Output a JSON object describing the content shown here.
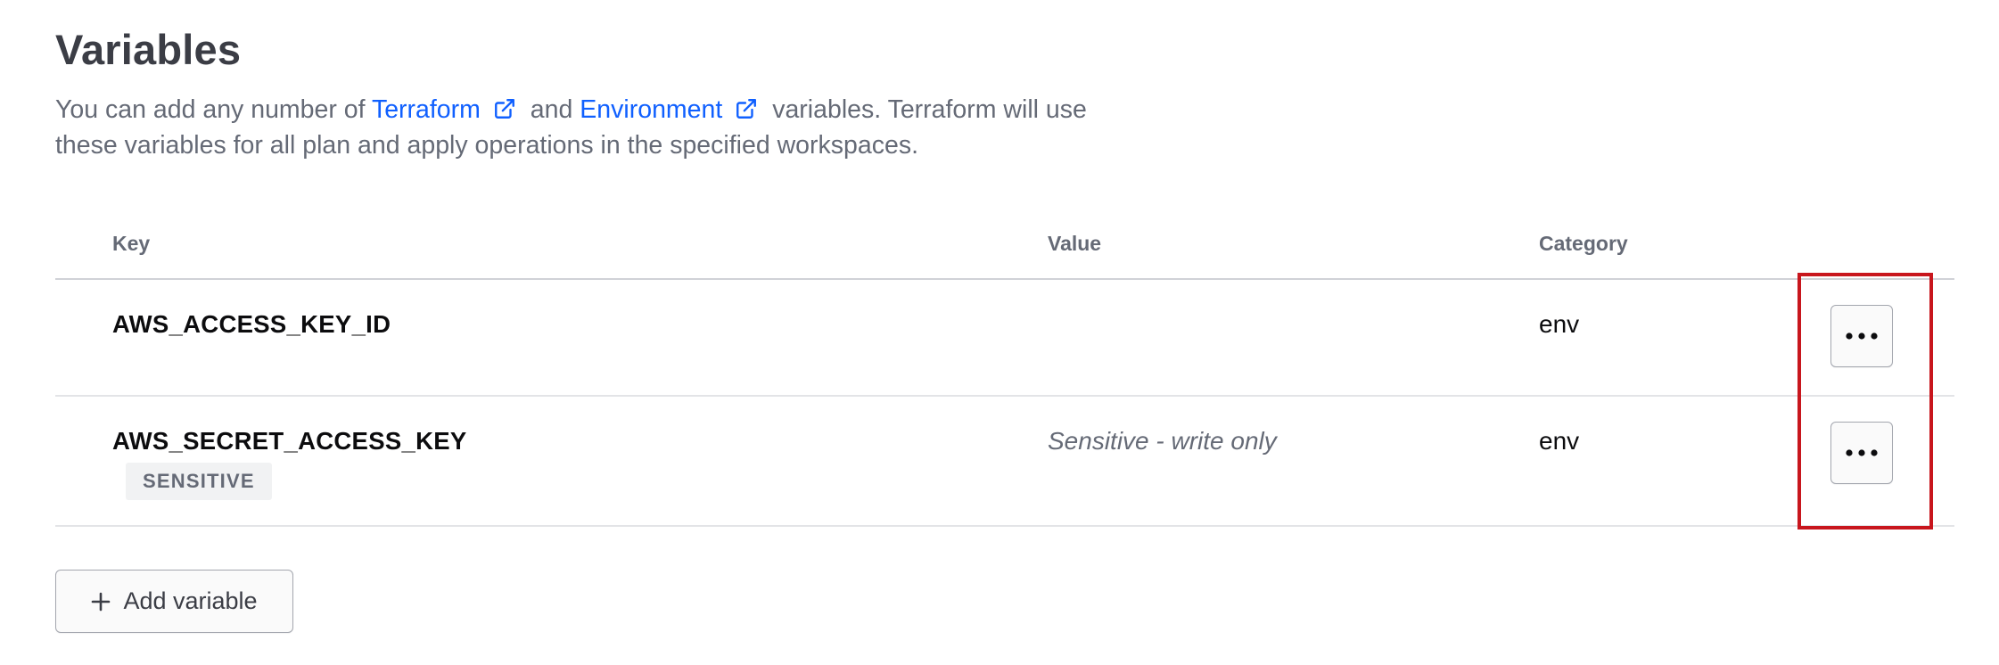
{
  "page": {
    "title": "Variables",
    "description": {
      "intro": "You can add any number of ",
      "link_terraform": "Terraform",
      "middle": " and ",
      "link_environment": "Environment",
      "outro": " variables. Terraform will use these variables for all plan and apply operations in the specified workspaces."
    }
  },
  "table": {
    "headers": {
      "key": "Key",
      "value": "Value",
      "category": "Category"
    },
    "rows": [
      {
        "key": "AWS_ACCESS_KEY_ID",
        "value": "",
        "category": "env",
        "badge": ""
      },
      {
        "key": "AWS_SECRET_ACCESS_KEY",
        "value": "Sensitive - write only",
        "category": "env",
        "badge": "SENSITIVE"
      }
    ]
  },
  "actions": {
    "add_variable_label": "Add variable",
    "overflow_icon": "more-horizontal-icon"
  },
  "colors": {
    "link": "#1060ff",
    "highlight": "#c8161d",
    "muted_text": "#656a76"
  }
}
